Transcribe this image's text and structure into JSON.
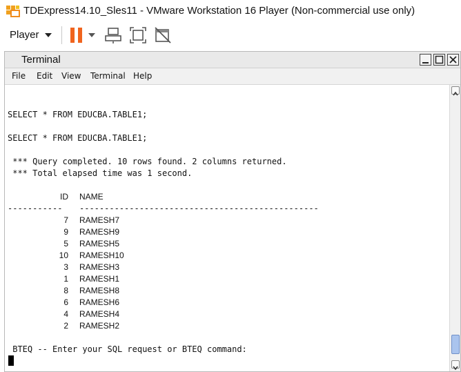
{
  "window": {
    "title": "TDExpress14.10_Sles11 - VMware Workstation 16 Player (Non-commercial use only)"
  },
  "toolbar": {
    "player_label": "Player",
    "icons": [
      "pause-icon",
      "dropdown-caret-icon",
      "send-ctrl-alt-del-icon",
      "fit-guest-icon",
      "unity-icon"
    ],
    "accent_color": "#f0641e"
  },
  "terminal": {
    "title": "Terminal",
    "menu": [
      "File",
      "Edit",
      "View",
      "Terminal",
      "Help"
    ],
    "lines": {
      "sql_1": "SELECT * FROM EDUCBA.TABLE1;",
      "sql_2": "SELECT * FROM EDUCBA.TABLE1;",
      "status_1": " *** Query completed. 10 rows found. 2 columns returned.",
      "status_2": " *** Total elapsed time was 1 second.",
      "prompt": " BTEQ -- Enter your SQL request or BTEQ command:"
    },
    "result_table": {
      "headers": [
        "ID",
        "NAME"
      ],
      "id_rule": "-----------",
      "name_rule": "------------------------------------------------",
      "rows": [
        [
          "7",
          "RAMESH7"
        ],
        [
          "9",
          "RAMESH9"
        ],
        [
          "5",
          "RAMESH5"
        ],
        [
          "10",
          "RAMESH10"
        ],
        [
          "3",
          "RAMESH3"
        ],
        [
          "1",
          "RAMESH1"
        ],
        [
          "8",
          "RAMESH8"
        ],
        [
          "6",
          "RAMESH6"
        ],
        [
          "4",
          "RAMESH4"
        ],
        [
          "2",
          "RAMESH2"
        ]
      ]
    }
  }
}
